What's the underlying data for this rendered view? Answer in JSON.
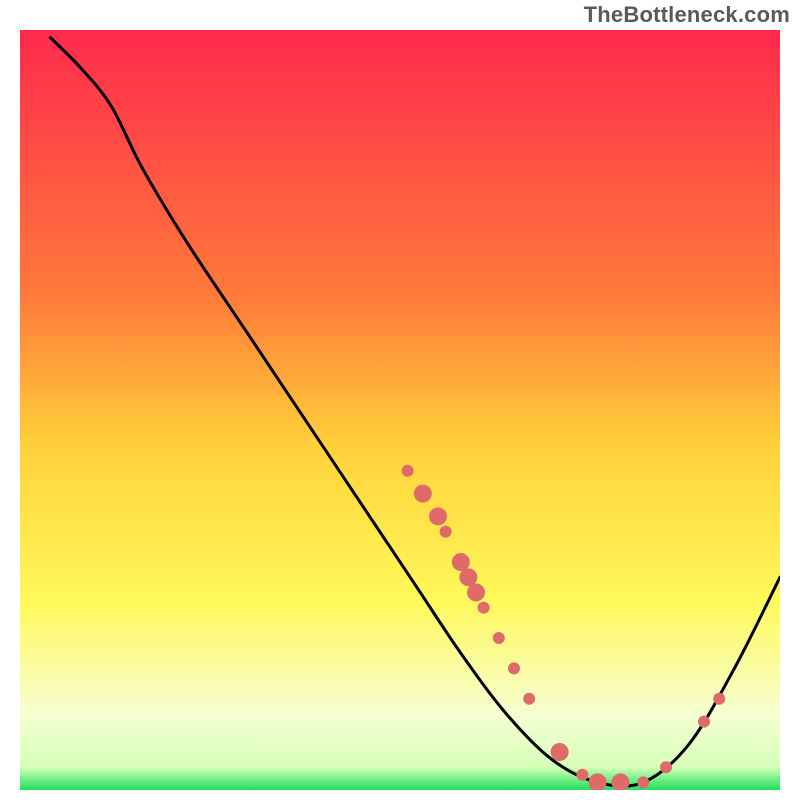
{
  "watermark": "TheBottleneck.com",
  "chart_data": {
    "type": "line",
    "title": "",
    "xlabel": "",
    "ylabel": "",
    "xlim": [
      0,
      100
    ],
    "ylim": [
      0,
      100
    ],
    "gradient_stops": [
      {
        "offset": 0,
        "color": "#ff2a4d"
      },
      {
        "offset": 35,
        "color": "#ff7a3a"
      },
      {
        "offset": 55,
        "color": "#ffd23a"
      },
      {
        "offset": 75,
        "color": "#fff85a"
      },
      {
        "offset": 90,
        "color": "#f6ffd2"
      },
      {
        "offset": 97,
        "color": "#d6ffb8"
      },
      {
        "offset": 100,
        "color": "#1fe05a"
      }
    ],
    "curve": {
      "name": "bottleneck-curve",
      "color": "#000000",
      "points": [
        {
          "x": 4,
          "y": 99
        },
        {
          "x": 8,
          "y": 95
        },
        {
          "x": 12,
          "y": 90
        },
        {
          "x": 16,
          "y": 82
        },
        {
          "x": 22,
          "y": 72
        },
        {
          "x": 30,
          "y": 60
        },
        {
          "x": 38,
          "y": 48
        },
        {
          "x": 46,
          "y": 36
        },
        {
          "x": 52,
          "y": 27
        },
        {
          "x": 58,
          "y": 18
        },
        {
          "x": 64,
          "y": 10
        },
        {
          "x": 70,
          "y": 4
        },
        {
          "x": 76,
          "y": 1
        },
        {
          "x": 82,
          "y": 1
        },
        {
          "x": 88,
          "y": 6
        },
        {
          "x": 94,
          "y": 16
        },
        {
          "x": 100,
          "y": 28
        }
      ]
    },
    "markers": {
      "color": "#e06a6a",
      "radius_small": 6,
      "radius_large": 9,
      "points": [
        {
          "x": 51,
          "y": 42,
          "r": "small"
        },
        {
          "x": 53,
          "y": 39,
          "r": "large"
        },
        {
          "x": 55,
          "y": 36,
          "r": "large"
        },
        {
          "x": 56,
          "y": 34,
          "r": "small"
        },
        {
          "x": 58,
          "y": 30,
          "r": "large"
        },
        {
          "x": 59,
          "y": 28,
          "r": "large"
        },
        {
          "x": 60,
          "y": 26,
          "r": "large"
        },
        {
          "x": 61,
          "y": 24,
          "r": "small"
        },
        {
          "x": 63,
          "y": 20,
          "r": "small"
        },
        {
          "x": 65,
          "y": 16,
          "r": "small"
        },
        {
          "x": 67,
          "y": 12,
          "r": "small"
        },
        {
          "x": 71,
          "y": 5,
          "r": "large"
        },
        {
          "x": 74,
          "y": 2,
          "r": "small"
        },
        {
          "x": 76,
          "y": 1,
          "r": "large"
        },
        {
          "x": 79,
          "y": 1,
          "r": "large"
        },
        {
          "x": 82,
          "y": 1,
          "r": "small"
        },
        {
          "x": 85,
          "y": 3,
          "r": "small"
        },
        {
          "x": 90,
          "y": 9,
          "r": "small"
        },
        {
          "x": 92,
          "y": 12,
          "r": "small"
        }
      ]
    }
  }
}
